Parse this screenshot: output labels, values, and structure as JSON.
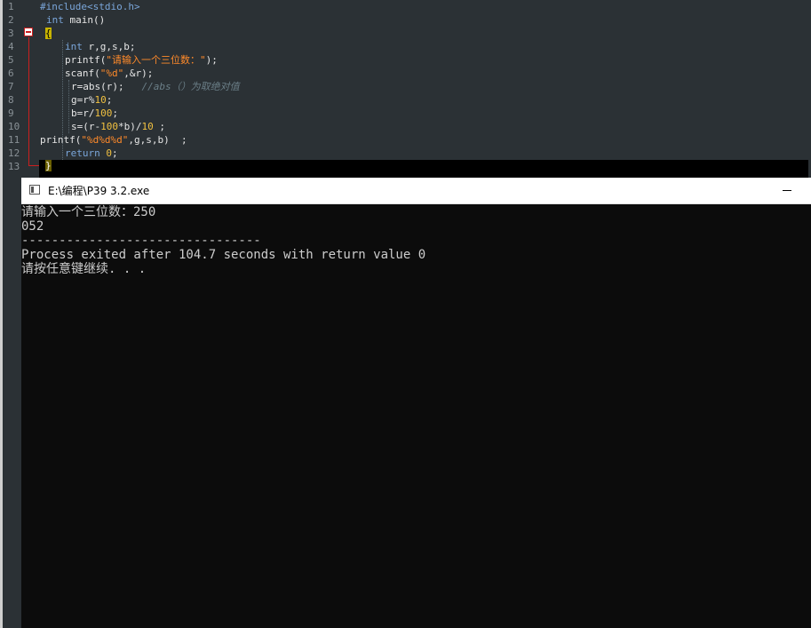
{
  "editor": {
    "line_numbers": [
      "1",
      "2",
      "3",
      "4",
      "5",
      "6",
      "7",
      "8",
      "9",
      "10",
      "11",
      "12",
      "13"
    ],
    "code": {
      "l1": "#include<stdio.h>",
      "l2_kw": "int",
      "l2_rest": " main()",
      "l3_brace": "{",
      "l4_kw": "int",
      "l4_rest": " r,g,s,b;",
      "l5_a": "printf(",
      "l5_str": "\"请输入一个三位数：\"",
      "l5_b": ");",
      "l6_a": "scanf(",
      "l6_str": "\"%d\"",
      "l6_b": ",&r);",
      "l7_code": "r=abs(r);",
      "l7_cmt": "//abs（）为取绝对值",
      "l8_a": "g=r%",
      "l8_num": "10",
      "l8_b": ";",
      "l9_a": "b=r/",
      "l9_num": "100",
      "l9_b": ";",
      "l10_a": "s=(r-",
      "l10_num1": "100",
      "l10_b": "*b)/",
      "l10_num2": "10",
      "l10_c": " ;",
      "l11_a": "printf(",
      "l11_str": "\"%d%d%d\"",
      "l11_b": ",g,s,b)  ;",
      "l12_kw": "return",
      "l12_sp": " ",
      "l12_num": "0",
      "l12_b": ";",
      "l13_brace": "}"
    }
  },
  "console": {
    "title": "E:\\编程\\P39 3.2.exe",
    "lines": [
      "请输入一个三位数：250",
      "052",
      "--------------------------------",
      "Process exited after 104.7 seconds with return value 0",
      "请按任意键继续. . ."
    ]
  }
}
